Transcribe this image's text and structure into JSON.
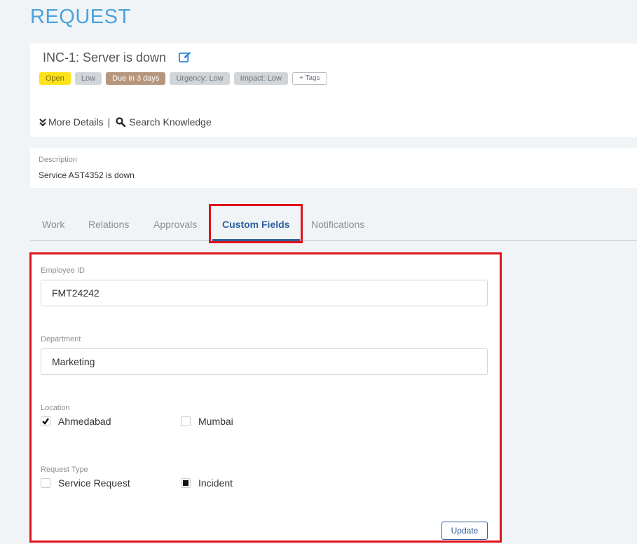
{
  "page": {
    "title": "REQUEST"
  },
  "request": {
    "title": "INC-1: Server is down",
    "badges": {
      "status": "Open",
      "priority": "Low",
      "due": "Due in 3 days",
      "urgency": "Urgency: Low",
      "impact": "Impact: Low",
      "tags": "+ Tags"
    },
    "links": {
      "more_details": "More Details",
      "separator": "|",
      "search_knowledge": "Search Knowledge"
    }
  },
  "description": {
    "label": "Description",
    "text": "Service AST4352 is down"
  },
  "tabs": [
    {
      "label": "Work",
      "active": false
    },
    {
      "label": "Relations",
      "active": false
    },
    {
      "label": "Approvals",
      "active": false
    },
    {
      "label": "Custom Fields",
      "active": true
    },
    {
      "label": "Notifications",
      "active": false
    }
  ],
  "custom_fields": {
    "employee_id": {
      "label": "Employee ID",
      "value": "FMT24242"
    },
    "department": {
      "label": "Department",
      "value": "Marketing"
    },
    "location": {
      "label": "Location",
      "options": [
        {
          "label": "Ahmedabad",
          "checked": true
        },
        {
          "label": "Mumbai",
          "checked": false
        }
      ]
    },
    "request_type": {
      "label": "Request Type",
      "options": [
        {
          "label": "Service Request",
          "selected": false
        },
        {
          "label": "Incident",
          "selected": true
        }
      ]
    },
    "update_label": "Update"
  },
  "colors": {
    "accent": "#4aa3df",
    "active_tab": "#2f5f9c",
    "highlight": "#e0131b",
    "open_badge": "#fde21b",
    "due_badge": "#b5967d"
  }
}
